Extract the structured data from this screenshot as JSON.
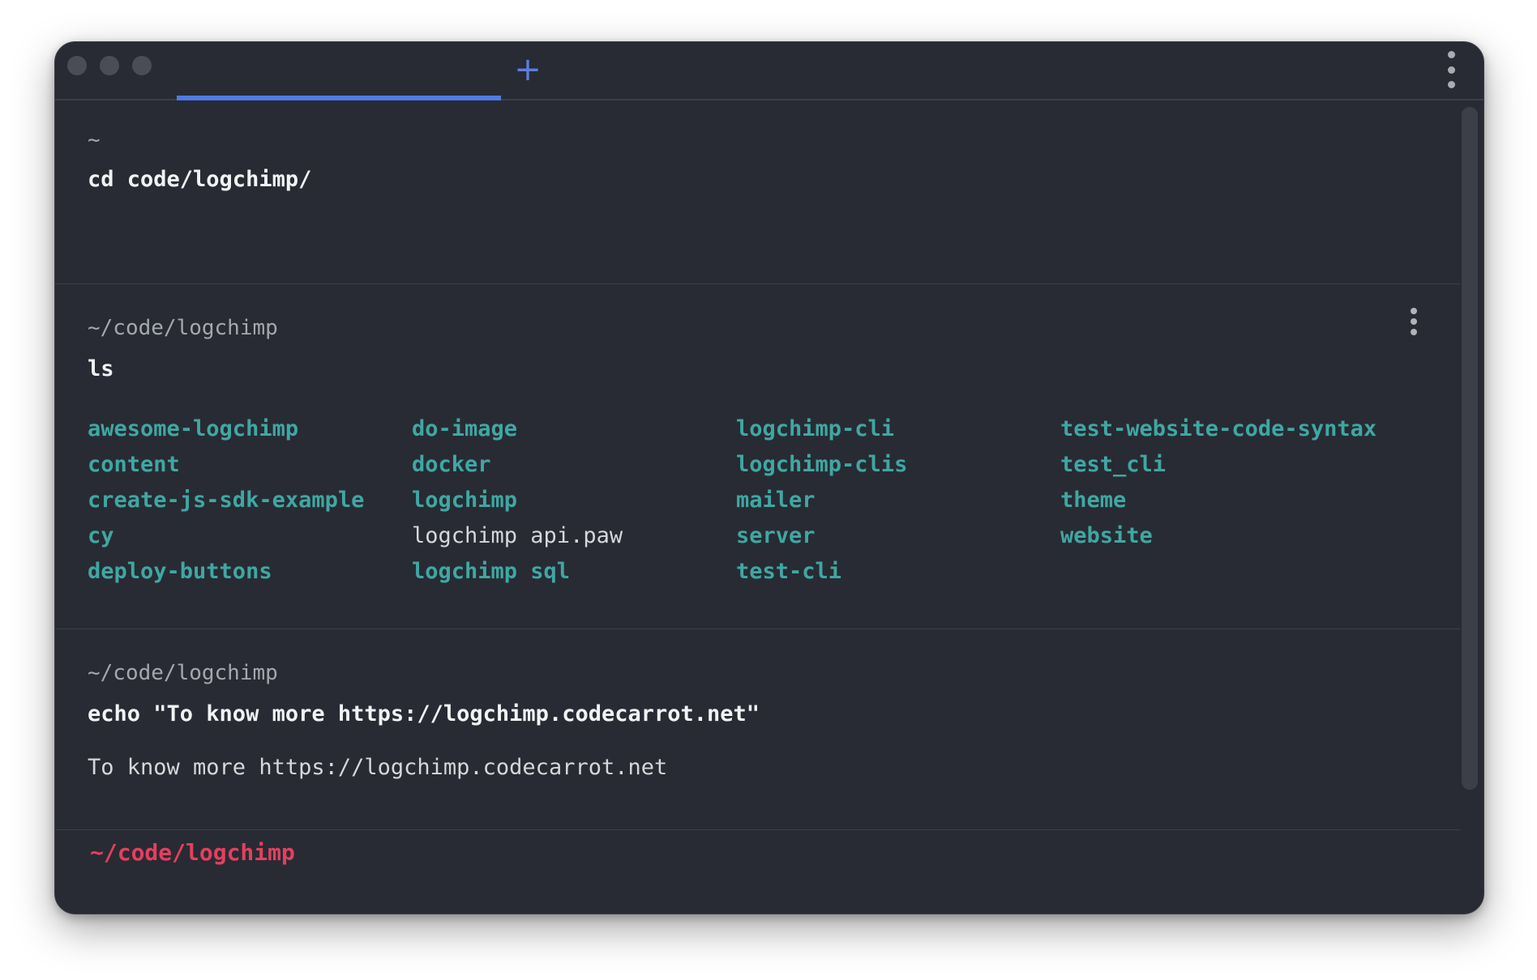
{
  "tabs": [
    {
      "label": "",
      "active": true
    }
  ],
  "new_tab_glyph": "+",
  "blocks": [
    {
      "path": "~",
      "command": "cd code/logchimp/"
    },
    {
      "path": "~/code/logchimp",
      "command": "ls",
      "ls_columns": [
        [
          {
            "name": "awesome-logchimp",
            "type": "dir"
          },
          {
            "name": "content",
            "type": "dir"
          },
          {
            "name": "create-js-sdk-example",
            "type": "dir"
          },
          {
            "name": "cy",
            "type": "dir"
          },
          {
            "name": "deploy-buttons",
            "type": "dir"
          }
        ],
        [
          {
            "name": "do-image",
            "type": "dir"
          },
          {
            "name": "docker",
            "type": "dir"
          },
          {
            "name": "logchimp",
            "type": "dir"
          },
          {
            "name": "logchimp api.paw",
            "type": "file"
          },
          {
            "name": "logchimp sql",
            "type": "dir"
          }
        ],
        [
          {
            "name": "logchimp-cli",
            "type": "dir"
          },
          {
            "name": "logchimp-clis",
            "type": "dir"
          },
          {
            "name": "mailer",
            "type": "dir"
          },
          {
            "name": "server",
            "type": "dir"
          },
          {
            "name": "test-cli",
            "type": "dir"
          }
        ],
        [
          {
            "name": "test-website-code-syntax",
            "type": "dir"
          },
          {
            "name": "test_cli",
            "type": "dir"
          },
          {
            "name": "theme",
            "type": "dir"
          },
          {
            "name": "website",
            "type": "dir"
          }
        ]
      ]
    },
    {
      "path": "~/code/logchimp",
      "command": "echo \"To know more https://logchimp.codecarrot.net\"",
      "output": "To know more https://logchimp.codecarrot.net"
    }
  ],
  "prompt": {
    "path": "~/code/logchimp"
  },
  "colors": {
    "background": "#282b33",
    "directory": "#3fa7a3",
    "file": "#d5d7db",
    "prompt": "#e43f5f",
    "accent": "#4f7be8"
  }
}
